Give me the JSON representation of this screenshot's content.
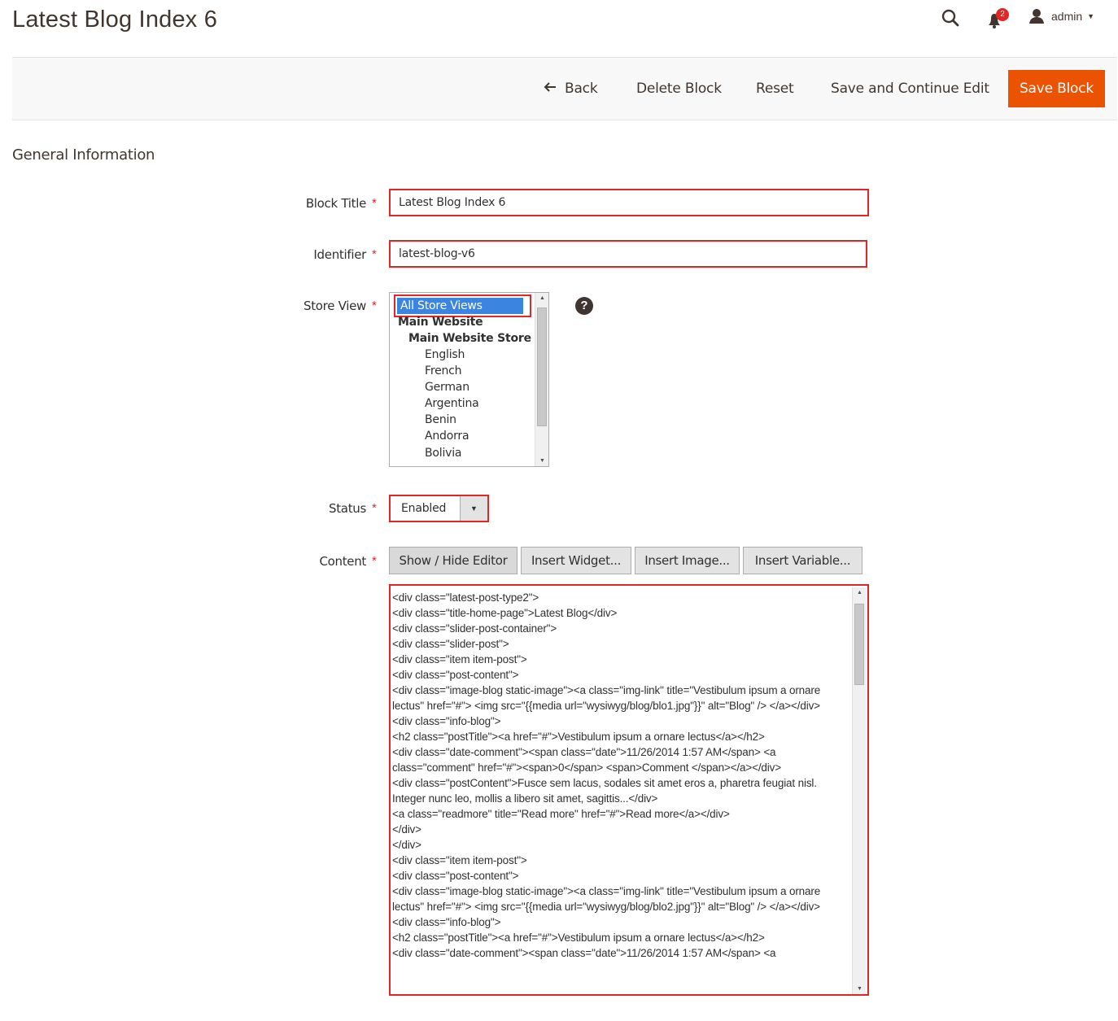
{
  "page": {
    "title": "Latest Blog Index 6"
  },
  "header": {
    "notifications_count": "2",
    "user_name": "admin"
  },
  "actions": {
    "back": "Back",
    "delete": "Delete Block",
    "reset": "Reset",
    "save_continue": "Save and Continue Edit",
    "save": "Save Block"
  },
  "form": {
    "section_title": "General Information",
    "block_title": {
      "label": "Block Title",
      "value": "Latest Blog Index 6"
    },
    "identifier": {
      "label": "Identifier",
      "value": "latest-blog-v6"
    },
    "store_view": {
      "label": "Store View",
      "options": [
        {
          "label": "All Store Views",
          "kind": "selected"
        },
        {
          "label": "Main Website",
          "kind": "group"
        },
        {
          "label": "Main Website Store",
          "kind": "subgroup"
        },
        {
          "label": "English",
          "kind": "item"
        },
        {
          "label": "French",
          "kind": "item"
        },
        {
          "label": "German",
          "kind": "item"
        },
        {
          "label": "Argentina",
          "kind": "item"
        },
        {
          "label": "Benin",
          "kind": "item"
        },
        {
          "label": "Andorra",
          "kind": "item"
        },
        {
          "label": "Bolivia",
          "kind": "item"
        }
      ]
    },
    "status": {
      "label": "Status",
      "value": "Enabled"
    },
    "content": {
      "label": "Content",
      "buttons": {
        "show_hide": "Show / Hide Editor",
        "insert_widget": "Insert Widget...",
        "insert_image": "Insert Image...",
        "insert_variable": "Insert Variable..."
      },
      "text": "<div class=\"latest-post-type2\">\n<div class=\"title-home-page\">Latest Blog</div>\n<div class=\"slider-post-container\">\n<div class=\"slider-post\">\n<div class=\"item item-post\">\n<div class=\"post-content\">\n<div class=\"image-blog static-image\"><a class=\"img-link\" title=\"Vestibulum ipsum a ornare lectus\" href=\"#\"> <img src=\"{{media url=\"wysiwyg/blog/blo1.jpg\"}}\" alt=\"Blog\" /> </a></div>\n<div class=\"info-blog\">\n<h2 class=\"postTitle\"><a href=\"#\">Vestibulum ipsum a ornare lectus</a></h2>\n<div class=\"date-comment\"><span class=\"date\">11/26/2014 1:57 AM</span> <a class=\"comment\" href=\"#\"><span>0</span> <span>Comment </span></a></div>\n<div class=\"postContent\">Fusce sem lacus, sodales sit amet eros a, pharetra feugiat nisl. Integer nunc leo, mollis a libero sit amet, sagittis...</div>\n<a class=\"readmore\" title=\"Read more\" href=\"#\">Read more</a></div>\n</div>\n</div>\n<div class=\"item item-post\">\n<div class=\"post-content\">\n<div class=\"image-blog static-image\"><a class=\"img-link\" title=\"Vestibulum ipsum a ornare lectus\" href=\"#\"> <img src=\"{{media url=\"wysiwyg/blog/blo2.jpg\"}}\" alt=\"Blog\" /> </a></div>\n<div class=\"info-blog\">\n<h2 class=\"postTitle\"><a href=\"#\">Vestibulum ipsum a ornare lectus</a></h2>\n<div class=\"date-comment\"><span class=\"date\">11/26/2014 1:57 AM</span> <a"
    }
  },
  "icons": {
    "search": "search-icon",
    "bell": "bell-icon",
    "user": "user-icon",
    "back": "arrow-left-icon",
    "help": "help-icon"
  },
  "colors": {
    "accent": "#eb5202",
    "error_outline": "#e22626",
    "selected_option": "#3b84e0",
    "text": "#41362f"
  }
}
